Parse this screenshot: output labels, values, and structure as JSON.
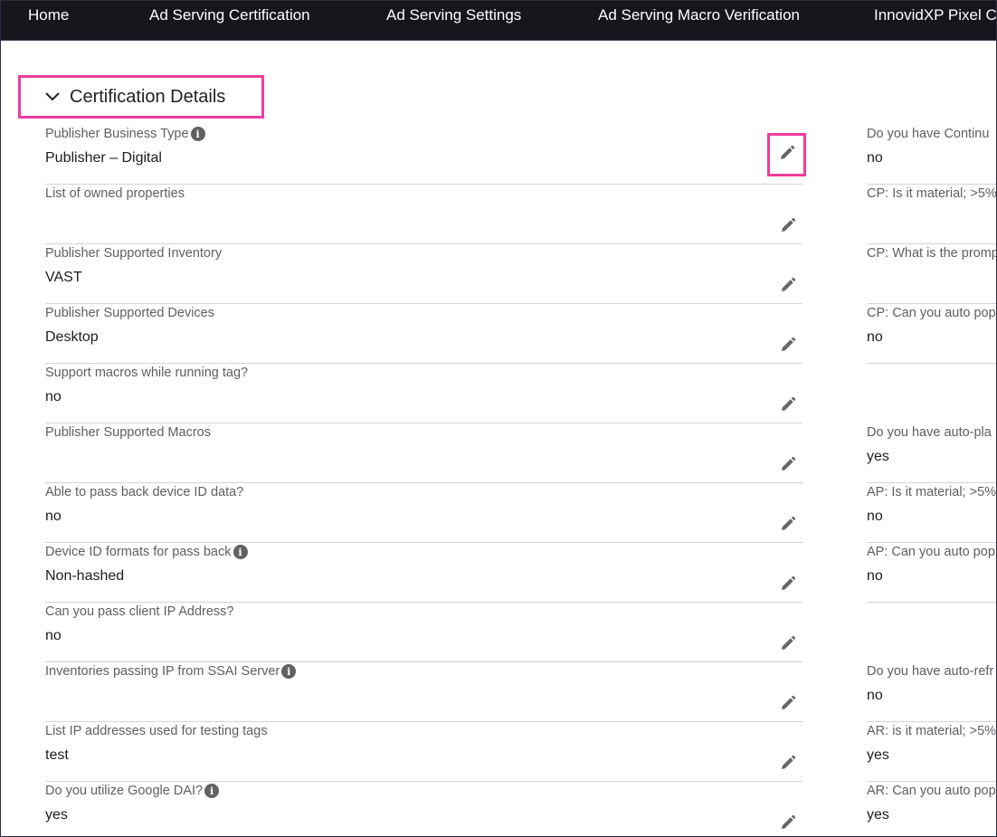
{
  "nav": {
    "home": "Home",
    "ad_serving_certification": "Ad Serving Certification",
    "ad_serving_settings": "Ad Serving Settings",
    "ad_serving_macro_verification": "Ad Serving Macro Verification",
    "innovidxp_pixel": "InnovidXP Pixel Ce"
  },
  "section": {
    "title": "Certification Details"
  },
  "colors": {
    "highlight": "#ee3d9b",
    "nav_bg": "#16161c"
  },
  "left_fields": [
    {
      "label": "Publisher Business Type",
      "value": "Publisher – Digital",
      "info": true
    },
    {
      "label": "List of owned properties",
      "value": ""
    },
    {
      "label": "Publisher Supported Inventory",
      "value": "VAST"
    },
    {
      "label": "Publisher Supported Devices",
      "value": "Desktop"
    },
    {
      "label": "Support macros while running tag?",
      "value": "no"
    },
    {
      "label": "Publisher Supported Macros",
      "value": ""
    },
    {
      "label": "Able to pass back device ID data?",
      "value": "no"
    },
    {
      "label": "Device ID formats for pass back",
      "value": "Non-hashed",
      "info": true
    },
    {
      "label": "Can you pass client IP Address?",
      "value": "no"
    },
    {
      "label": "Inventories passing IP from SSAI Server",
      "value": "",
      "info": true
    },
    {
      "label": "List IP addresses used for testing tags",
      "value": "test"
    },
    {
      "label": "Do you utilize Google DAI?",
      "value": "yes",
      "info": true
    }
  ],
  "right_fields": [
    {
      "label": "Do you have Continu",
      "value": "no"
    },
    {
      "label": "CP: Is it material; >5%",
      "value": ""
    },
    {
      "label": "CP: What is the promp",
      "value": ""
    },
    {
      "label": "CP: Can you auto pop",
      "value": "no"
    },
    {
      "label": "",
      "value": ""
    },
    {
      "label": "Do you have auto-pla",
      "value": "yes"
    },
    {
      "label": "AP: Is it material; >5%",
      "value": "no"
    },
    {
      "label": "AP: Can you auto pop",
      "value": "no"
    },
    {
      "label": "",
      "value": ""
    },
    {
      "label": "Do you have auto-refr",
      "value": "no"
    },
    {
      "label": "AR: is it material; >5%",
      "value": "yes"
    },
    {
      "label": "AR: Can you auto pop",
      "value": "yes"
    }
  ]
}
